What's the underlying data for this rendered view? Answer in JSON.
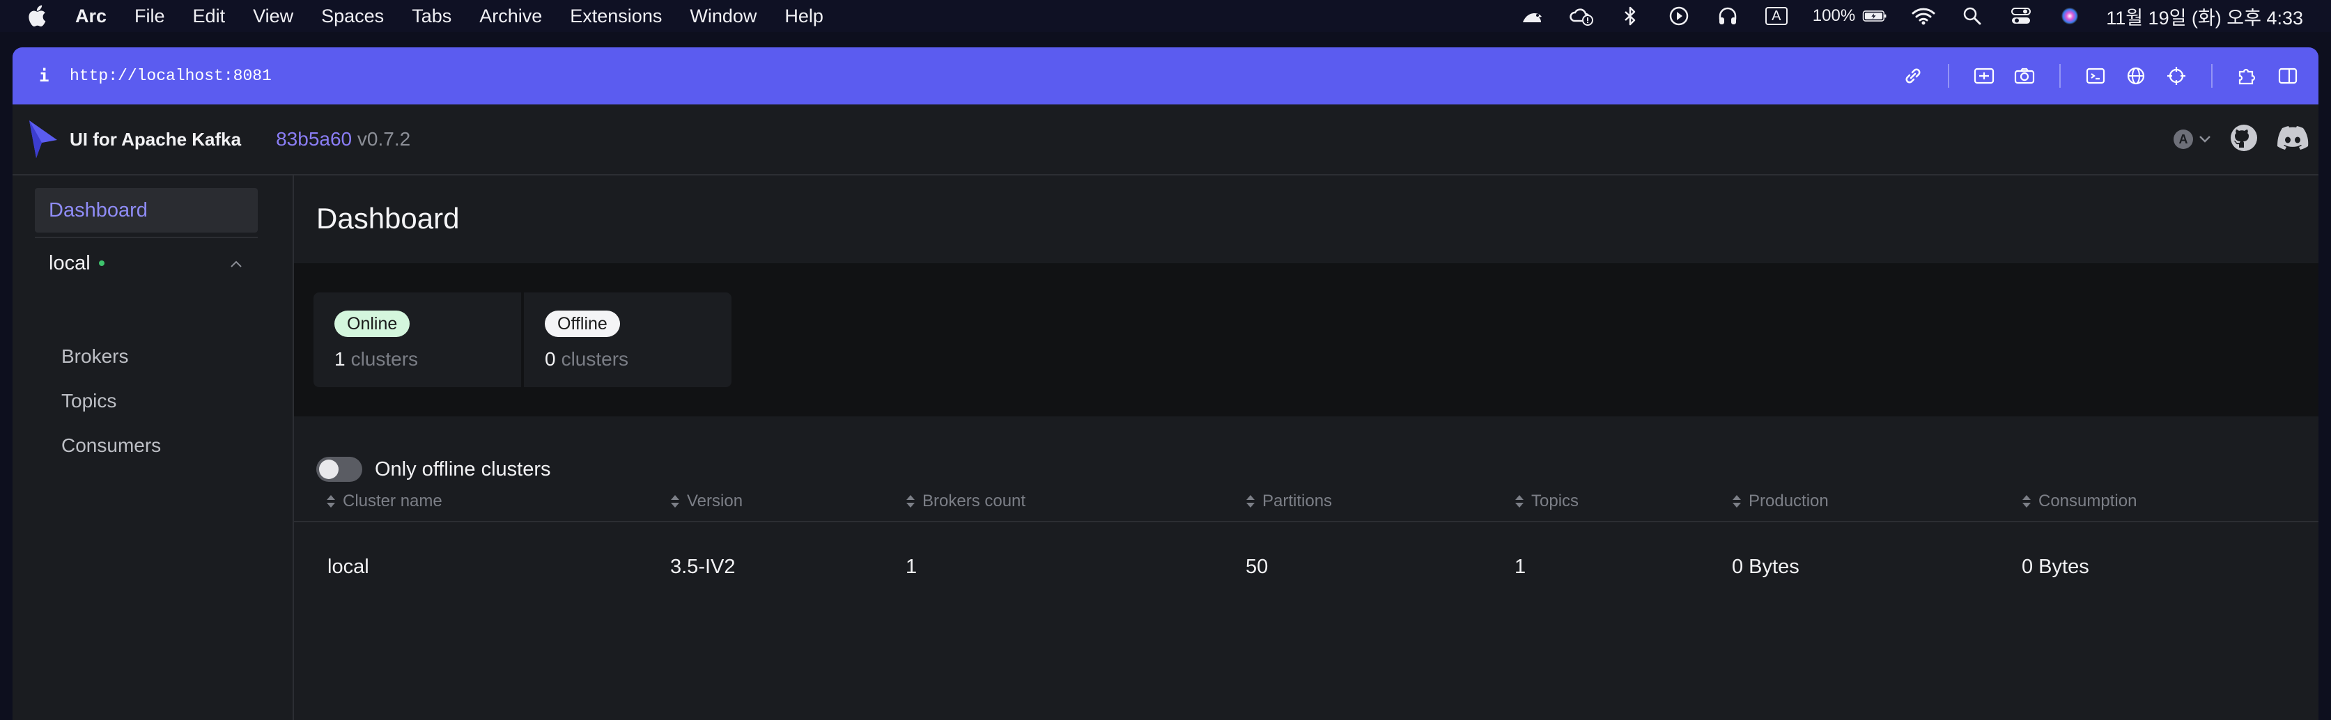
{
  "menubar": {
    "app_name": "Arc",
    "items": [
      "File",
      "Edit",
      "View",
      "Spaces",
      "Tabs",
      "Archive",
      "Extensions",
      "Window",
      "Help"
    ],
    "input_source": "A",
    "battery": "100%",
    "clock": "11월 19일 (화) 오후 4:33"
  },
  "browser": {
    "url": "http://localhost:8081",
    "info_icon": "i"
  },
  "app": {
    "name": "UI for Apache Kafka",
    "commit_hash": "83b5a60",
    "version": "v0.7.2",
    "language_badge": "A"
  },
  "sidebar": {
    "dashboard_label": "Dashboard",
    "cluster": {
      "name": "local",
      "status_color": "#3ec46d",
      "items": [
        "Brokers",
        "Topics",
        "Consumers"
      ]
    }
  },
  "main": {
    "title": "Dashboard",
    "stats": {
      "online": {
        "badge": "Online",
        "count": "1",
        "unit": "clusters"
      },
      "offline": {
        "badge": "Offline",
        "count": "0",
        "unit": "clusters"
      }
    },
    "toggle": {
      "label": "Only offline clusters",
      "checked": false
    },
    "table": {
      "columns": [
        "Cluster name",
        "Version",
        "Brokers count",
        "Partitions",
        "Topics",
        "Production",
        "Consumption"
      ],
      "rows": [
        [
          "local",
          "3.5-IV2",
          "1",
          "50",
          "1",
          "0 Bytes",
          "0 Bytes"
        ]
      ]
    }
  },
  "colors": {
    "url_bar": "#5b5cf0",
    "accent": "#8f8cf6",
    "online_badge": "#d4f6dd"
  }
}
